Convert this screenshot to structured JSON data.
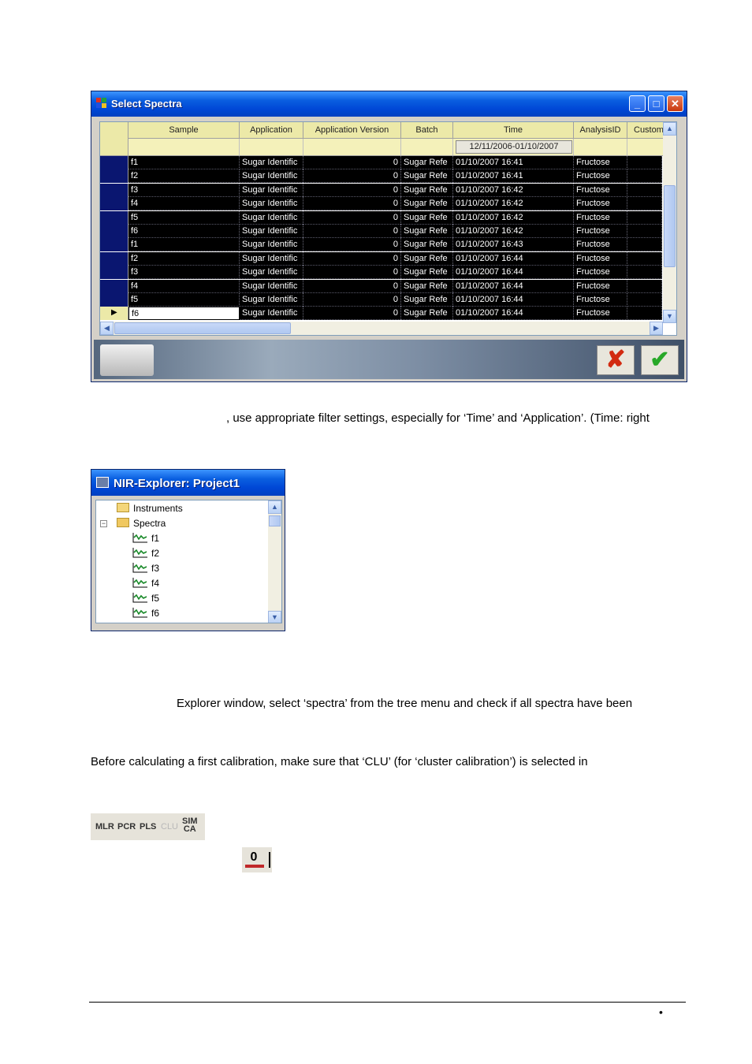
{
  "select_spectra": {
    "title": "Select Spectra",
    "columns": [
      "Sample",
      "Application",
      "Application Version",
      "Batch",
      "Time",
      "AnalysisID",
      "Custom"
    ],
    "time_filter": "12/11/2006-01/10/2007",
    "rows": [
      {
        "sample": "f1",
        "application": "Sugar Identific",
        "version": "0",
        "batch": "Sugar Refe",
        "time": "01/10/2007 16:41",
        "analysis": "Fructose"
      },
      {
        "sample": "f2",
        "application": "Sugar Identific",
        "version": "0",
        "batch": "Sugar Refe",
        "time": "01/10/2007 16:41",
        "analysis": "Fructose"
      },
      {
        "sample": "f3",
        "application": "Sugar Identific",
        "version": "0",
        "batch": "Sugar Refe",
        "time": "01/10/2007 16:42",
        "analysis": "Fructose"
      },
      {
        "sample": "f4",
        "application": "Sugar Identific",
        "version": "0",
        "batch": "Sugar Refe",
        "time": "01/10/2007 16:42",
        "analysis": "Fructose"
      },
      {
        "sample": "f5",
        "application": "Sugar Identific",
        "version": "0",
        "batch": "Sugar Refe",
        "time": "01/10/2007 16:42",
        "analysis": "Fructose"
      },
      {
        "sample": "f6",
        "application": "Sugar Identific",
        "version": "0",
        "batch": "Sugar Refe",
        "time": "01/10/2007 16:42",
        "analysis": "Fructose"
      },
      {
        "sample": "f1",
        "application": "Sugar Identific",
        "version": "0",
        "batch": "Sugar Refe",
        "time": "01/10/2007 16:43",
        "analysis": "Fructose"
      },
      {
        "sample": "f2",
        "application": "Sugar Identific",
        "version": "0",
        "batch": "Sugar Refe",
        "time": "01/10/2007 16:44",
        "analysis": "Fructose"
      },
      {
        "sample": "f3",
        "application": "Sugar Identific",
        "version": "0",
        "batch": "Sugar Refe",
        "time": "01/10/2007 16:44",
        "analysis": "Fructose"
      },
      {
        "sample": "f4",
        "application": "Sugar Identific",
        "version": "0",
        "batch": "Sugar Refe",
        "time": "01/10/2007 16:44",
        "analysis": "Fructose"
      },
      {
        "sample": "f5",
        "application": "Sugar Identific",
        "version": "0",
        "batch": "Sugar Refe",
        "time": "01/10/2007 16:44",
        "analysis": "Fructose"
      },
      {
        "sample": "f6",
        "application": "Sugar Identific",
        "version": "0",
        "batch": "Sugar Refe",
        "time": "01/10/2007 16:44",
        "analysis": "Fructose"
      }
    ],
    "cancel_icon": "red-x-icon",
    "ok_icon": "green-check-icon"
  },
  "text": {
    "para1": ", use appropriate filter settings, especially for ‘Time’ and ‘Application’. (Time: right",
    "para2": "Explorer window, select ‘spectra’ from the tree menu and check if all spectra have been",
    "para3": "Before calculating a first calibration, make sure that ‘CLU’ (for ‘cluster calibration’) is selected in"
  },
  "nir_explorer": {
    "title": "NIR-Explorer: Project1",
    "root_items": [
      {
        "label": "Instruments"
      },
      {
        "label": "Spectra"
      }
    ],
    "spectra_children": [
      "f1",
      "f2",
      "f3",
      "f4",
      "f5",
      "f6"
    ]
  },
  "method_toolbar": {
    "buttons": [
      "MLR",
      "PCR",
      "PLS",
      "CLU"
    ],
    "simca_top": "SIM",
    "simca_bottom": "CA"
  },
  "calibration_icon": {
    "label": "0"
  },
  "page_footer": {
    "bullet": "•"
  }
}
